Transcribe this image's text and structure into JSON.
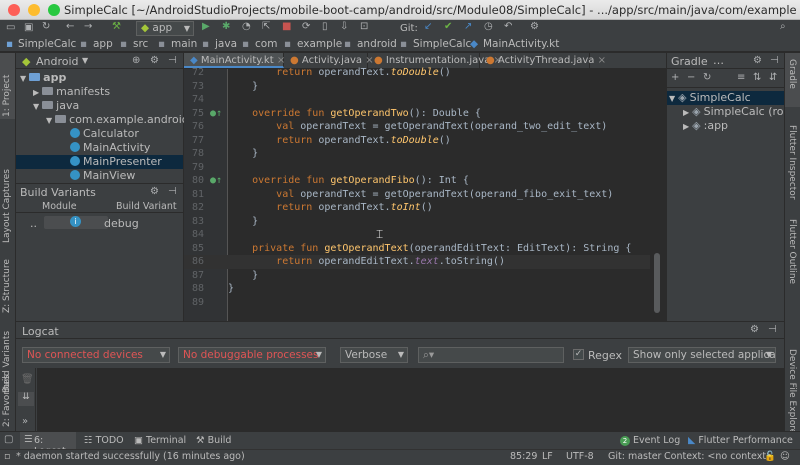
{
  "window": {
    "title": "SimpleCalc [~/AndroidStudioProjects/mobile-boot-camp/android/src/Module08/SimpleCalc] - .../app/src/main/java/com/example/android/SimpleCalc/MainActivity.kt [app]"
  },
  "toolbar": {
    "run_config": "app",
    "git_label": "Git:"
  },
  "breadcrumb": [
    "SimpleCalc",
    "app",
    "src",
    "main",
    "java",
    "com",
    "example",
    "android",
    "SimpleCalc",
    "MainActivity.kt"
  ],
  "project": {
    "view": "Android",
    "tree": [
      {
        "label": "app",
        "indent": 0,
        "kind": "module"
      },
      {
        "label": "manifests",
        "indent": 1,
        "kind": "folder"
      },
      {
        "label": "java",
        "indent": 1,
        "kind": "folder"
      },
      {
        "label": "com.example.android.Sim",
        "indent": 2,
        "kind": "folder"
      },
      {
        "label": "Calculator",
        "indent": 3,
        "kind": "class"
      },
      {
        "label": "MainActivity",
        "indent": 3,
        "kind": "class"
      },
      {
        "label": "MainPresenter",
        "indent": 3,
        "kind": "class"
      },
      {
        "label": "MainView",
        "indent": 3,
        "kind": "class"
      }
    ]
  },
  "build_variants": {
    "title": "Build Variants",
    "col_module": "Module",
    "col_variant": "Build Variant",
    "row_module": "..",
    "row_variant": "debug"
  },
  "editor": {
    "tabs": [
      "MainActivity.kt",
      "Activity.java",
      "Instrumentation.java",
      "ActivityThread.java"
    ],
    "active_tab": 0,
    "first_line": 73,
    "top_fragment": "return operandText.toDouble()"
  },
  "gradle": {
    "title": "Gradle",
    "items": [
      {
        "label": "SimpleCalc",
        "indent": 0
      },
      {
        "label": "SimpleCalc (root)",
        "indent": 1
      },
      {
        "label": ":app",
        "indent": 1
      }
    ]
  },
  "left_tools": [
    "1: Project",
    "Layout Captures",
    "Z: Structure",
    "Build Variants",
    "2: Favorites"
  ],
  "right_tools": [
    "Gradle",
    "Flutter Inspector",
    "Flutter Outline",
    "Device File Explorer"
  ],
  "logcat": {
    "title": "Logcat",
    "device": "No connected devices",
    "process": "No debuggable processes",
    "level": "Verbose",
    "search_placeholder": "",
    "regex_label": "Regex",
    "filter": "Show only selected applicat"
  },
  "bottom_tabs": [
    "6: Logcat",
    "TODO",
    "Terminal",
    "Build"
  ],
  "bottom_right": [
    "Event Log",
    "Flutter Performance"
  ],
  "status": {
    "message": "* daemon started successfully (16 minutes ago)",
    "position": "85:29",
    "line_sep": "LF",
    "encoding": "UTF-8",
    "git": "Git: master",
    "context": "Context: <no context>"
  },
  "colors": {
    "background": "#2b2b2b",
    "panel": "#3c3f41",
    "keyword": "#cc7832",
    "function": "#ffc66d",
    "property": "#9876aa",
    "error_text": "#e05555",
    "selection": "#0d293e"
  }
}
